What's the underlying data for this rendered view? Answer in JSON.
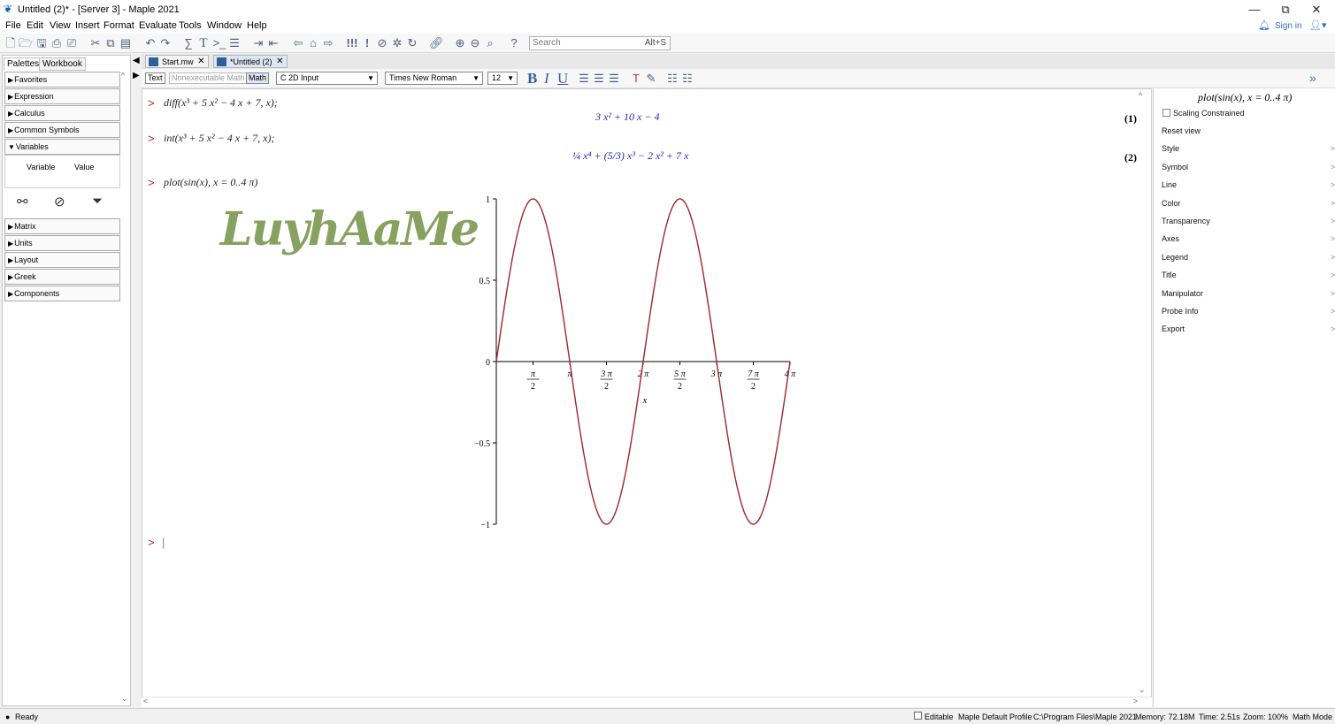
{
  "window": {
    "title": "Untitled (2)* - [Server 3] - Maple 2021",
    "minimize": "—",
    "restore": "⧉",
    "close": "✕"
  },
  "menu": [
    "File",
    "Edit",
    "View",
    "Insert",
    "Format",
    "Evaluate",
    "Tools",
    "Window",
    "Help"
  ],
  "signin": "Sign in",
  "search": {
    "placeholder": "Search",
    "shortcut": "Alt+S"
  },
  "left_tabs": [
    "Palettes",
    "Workbook"
  ],
  "palettes": [
    "Favorites",
    "Expression",
    "Calculus",
    "Common Symbols",
    "Variables",
    "Matrix",
    "Units",
    "Layout",
    "Greek",
    "Components"
  ],
  "variables": {
    "col1": "Variable",
    "col2": "Value"
  },
  "doc_tabs": [
    "Start.mw",
    "*Untitled (2)"
  ],
  "context_bar": {
    "text": "Text",
    "nonexec": "Nonexecutable Math",
    "math": "Math",
    "input_mode": "2D Input",
    "font": "Times New Roman",
    "size": "12",
    "bold": "B",
    "italic": "I",
    "underline": "U"
  },
  "worksheet": {
    "inputs": [
      "diff(x³ + 5 x² − 4 x + 7, x);",
      "int(x³ + 5 x² − 4 x + 7, x);",
      "plot(sin(x), x = 0..4 π)"
    ],
    "outputs": [
      "3 x² + 10 x − 4",
      "¼ x⁴ + (5/3) x³ − 2 x² + 7 x"
    ],
    "labels": [
      "(1)",
      "(2)"
    ],
    "watermark": "LuyhAaMe"
  },
  "chart_data": {
    "type": "line",
    "function": "sin(x)",
    "x_range": [
      0,
      12.566
    ],
    "ylim": [
      -1,
      1
    ],
    "xlabel": "x",
    "yticks": [
      "1",
      "0.5",
      "0",
      "−0.5",
      "−1"
    ],
    "xticks": [
      {
        "num": "π",
        "den": "2"
      },
      {
        "num": "π",
        "den": ""
      },
      {
        "num": "3 π",
        "den": "2"
      },
      {
        "num": "2 π",
        "den": ""
      },
      {
        "num": "5 π",
        "den": "2"
      },
      {
        "num": "3 π",
        "den": ""
      },
      {
        "num": "7 π",
        "den": "2"
      },
      {
        "num": "4 π",
        "den": ""
      }
    ],
    "color": "#a0252e"
  },
  "context_panel": {
    "header": "plot(sin(x), x = 0..4 π)",
    "scaling": "Scaling Constrained",
    "items": [
      "Reset view",
      "Style",
      "Symbol",
      "Line",
      "Color",
      "Transparency",
      "Axes",
      "Legend",
      "Title",
      "Manipulator",
      "Probe Info",
      "Export"
    ]
  },
  "status": {
    "ready": "Ready",
    "editable": "Editable",
    "profile": "Maple Default Profile",
    "path": "C:\\Program Files\\Maple 2021",
    "memory": "Memory: 72.18M",
    "time": "Time: 2.51s",
    "zoom": "Zoom: 100%",
    "mode": "Math Mode"
  }
}
